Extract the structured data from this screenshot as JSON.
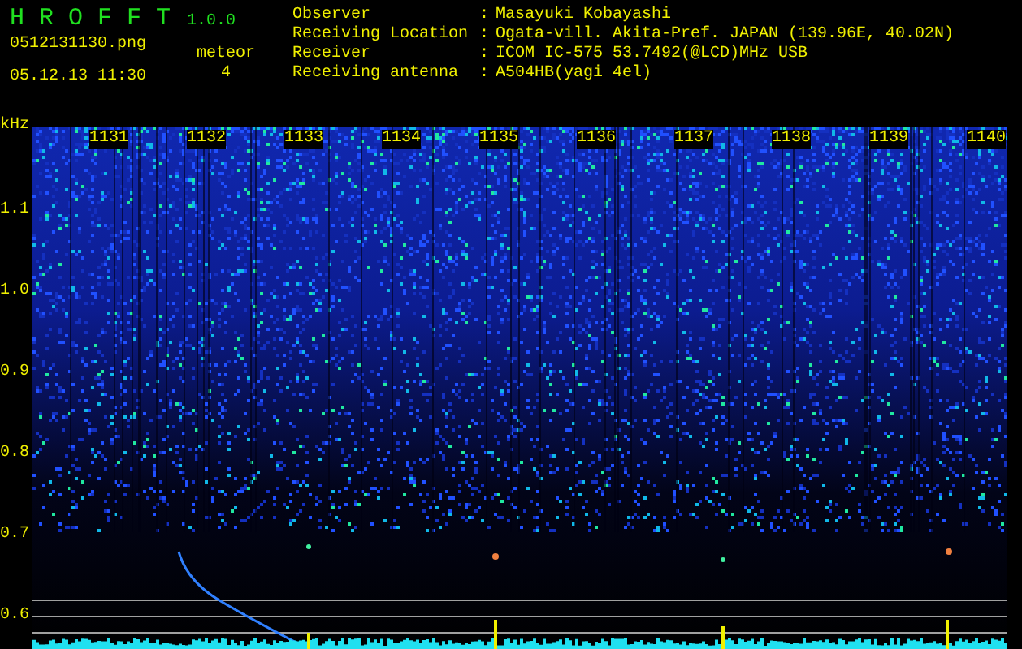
{
  "app": {
    "name": "H R O F F T",
    "version": "1.0.0"
  },
  "file": {
    "name": "0512131130.png",
    "timestamp": "05.12.13 11:30"
  },
  "meteor": {
    "label": "meteor",
    "count": "4"
  },
  "station": [
    {
      "label": "Observer",
      "separator": ":",
      "value": "Masayuki Kobayashi"
    },
    {
      "label": "Receiving Location",
      "separator": ":",
      "value": "Ogata-vill. Akita-Pref. JAPAN (139.96E, 40.02N)"
    },
    {
      "label": "Receiver",
      "separator": ":",
      "value": "ICOM IC-575 53.7492(@LCD)MHz USB"
    },
    {
      "label": "Receiving antenna",
      "separator": ":",
      "value": "A504HB(yagi 4el)"
    }
  ],
  "spectrogram": {
    "unit": "kHz",
    "time_labels": [
      "1131",
      "1132",
      "1133",
      "1134",
      "1135",
      "1136",
      "1137",
      "1138",
      "1139",
      "1140"
    ],
    "frequency_labels": [
      "1.1",
      "1.0",
      "0.9",
      "0.8",
      "0.7",
      "0.6"
    ]
  }
}
